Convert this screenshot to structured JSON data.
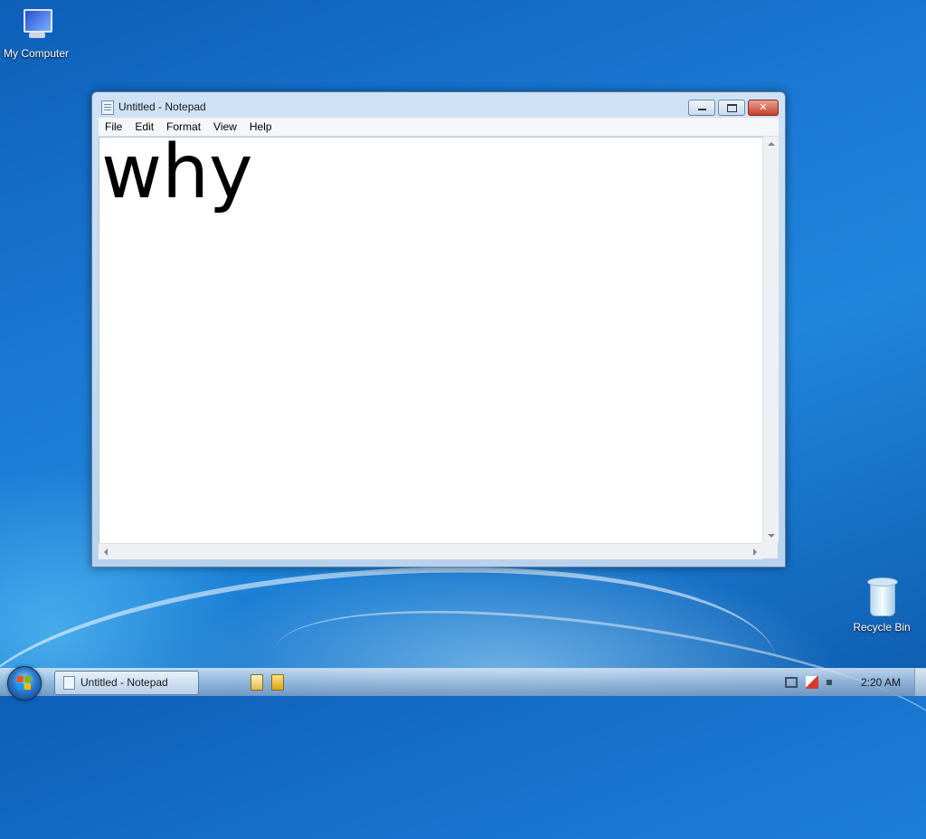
{
  "desktop": {
    "icons": [
      {
        "label": "My Computer"
      },
      {
        "label": "Recycle Bin"
      }
    ]
  },
  "window": {
    "title": "Untitled - Notepad",
    "menu": [
      "File",
      "Edit",
      "Format",
      "View",
      "Help"
    ],
    "content": "why"
  },
  "taskbar": {
    "task_label": "Untitled - Notepad",
    "clock": "2:20 AM"
  }
}
